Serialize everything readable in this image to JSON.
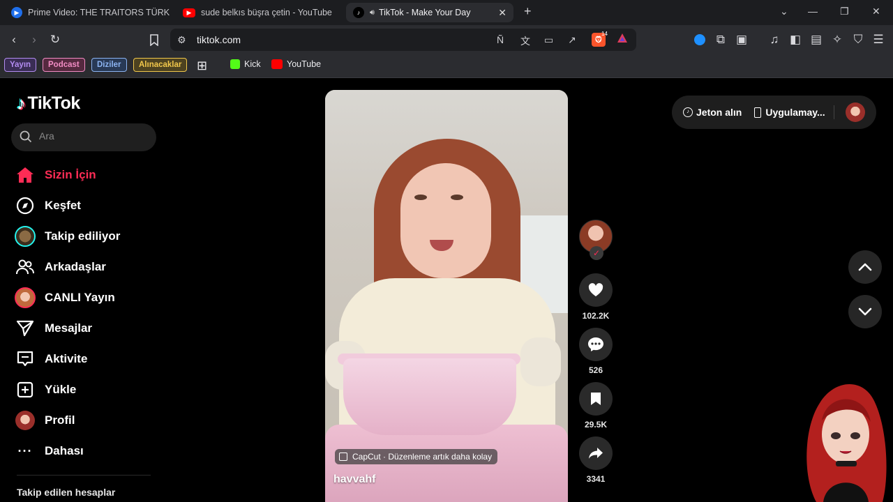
{
  "browser": {
    "tabs": [
      {
        "title": "Prime Video: THE TRAITORS TÜRKİYE",
        "active": false
      },
      {
        "title": "sude belkıs büşra çetin - YouTube",
        "active": false
      },
      {
        "title": "TikTok - Make Your Day",
        "active": true
      }
    ],
    "new_tab_icon": "plus-icon",
    "url": "tiktok.com",
    "brave_badge": "14",
    "bookmark_pills": [
      {
        "label": "Yayın",
        "color": "#b38cf2"
      },
      {
        "label": "Podcast",
        "color": "#f28cc4"
      },
      {
        "label": "Diziler",
        "color": "#8cb4f2"
      },
      {
        "label": "Alınacaklar",
        "color": "#f2c84b"
      }
    ],
    "bookmarks": [
      {
        "label": "Kick",
        "color": "#53fc18"
      },
      {
        "label": "YouTube",
        "color": "#ff0000"
      }
    ]
  },
  "tiktok": {
    "logo": "TikTok",
    "search_placeholder": "Ara",
    "nav": [
      {
        "label": "Sizin İçin",
        "icon": "home-icon",
        "active": true
      },
      {
        "label": "Keşfet",
        "icon": "compass-icon",
        "active": false
      },
      {
        "label": "Takip ediliyor",
        "icon": "following-avatar-icon",
        "active": false
      },
      {
        "label": "Arkadaşlar",
        "icon": "friends-icon",
        "active": false
      },
      {
        "label": "CANLI Yayın",
        "icon": "live-avatar-icon",
        "active": false
      },
      {
        "label": "Mesajlar",
        "icon": "send-icon",
        "active": false
      },
      {
        "label": "Aktivite",
        "icon": "activity-icon",
        "active": false
      },
      {
        "label": "Yükle",
        "icon": "upload-icon",
        "active": false
      },
      {
        "label": "Profil",
        "icon": "profile-avatar-icon",
        "active": false
      },
      {
        "label": "Dahası",
        "icon": "more-icon",
        "active": false
      }
    ],
    "followed_section_title": "Takip edilen hesaplar",
    "video": {
      "username": "havvahf",
      "capcut_label": "CapCut · Düzenleme artık daha kolay",
      "likes": "102.2K",
      "comments": "526",
      "saves": "29.5K",
      "shares": "3341"
    },
    "top_right": {
      "coins_label": "Jeton alın",
      "app_label": "Uygulamay..."
    },
    "accent": "#fe2c55"
  }
}
